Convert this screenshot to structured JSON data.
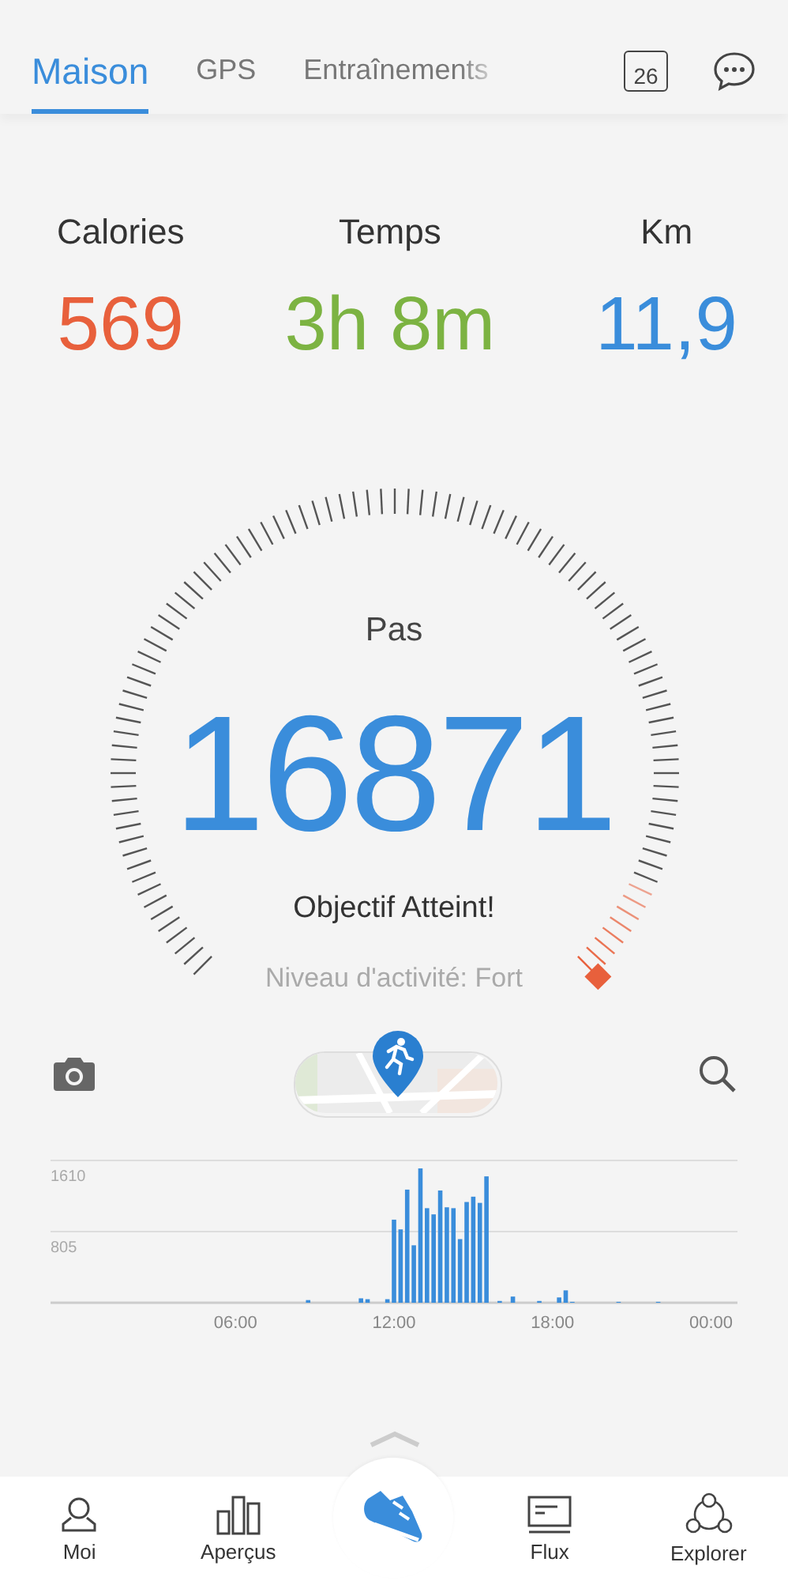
{
  "tabs": [
    {
      "label": "Maison",
      "selected": true
    },
    {
      "label": "GPS",
      "selected": false
    },
    {
      "label": "Entraînements",
      "selected": false
    }
  ],
  "calendar_day": "26",
  "stats": [
    {
      "label": "Calories",
      "value": "569",
      "color": "#e8603c"
    },
    {
      "label": "Temps",
      "value": "3h 8m",
      "color": "#7cb342"
    },
    {
      "label": "Km",
      "value": "11,9",
      "color": "#3a8ddb"
    }
  ],
  "gauge": {
    "title": "Pas",
    "value": "16871",
    "status": "Objectif Atteint!",
    "activity": "Niveau d'activité: Fort"
  },
  "chart_data": {
    "type": "bar",
    "x": [
      8.75,
      10.75,
      11,
      11.75,
      12,
      12.25,
      12.5,
      12.75,
      13,
      13.25,
      13.5,
      13.75,
      14,
      14.25,
      14.5,
      14.75,
      15,
      15.25,
      15.5,
      16,
      16.5,
      17.5,
      18.25,
      18.5,
      18.75,
      20.5,
      22
    ],
    "series": [
      {
        "color": "#3a8ddb",
        "values": [
          30,
          50,
          40,
          40,
          940,
          830,
          1280,
          650,
          1520,
          1070,
          1000,
          1270,
          1080,
          1070,
          720,
          1140,
          1200,
          1130,
          1430,
          20,
          70,
          20,
          60,
          140,
          10,
          10,
          10
        ]
      }
    ],
    "xlim": [
      -1,
      25
    ],
    "ylim": [
      0,
      1610
    ],
    "xticks": [
      {
        "value": 6,
        "label": "06:00"
      },
      {
        "value": 12,
        "label": "12:00"
      },
      {
        "value": 18,
        "label": "18:00"
      },
      {
        "value": 24,
        "label": "00:00"
      }
    ],
    "yticks": [
      805,
      1610
    ]
  },
  "nav": [
    {
      "label": "Moi",
      "kind": "person"
    },
    {
      "label": "Aperçus",
      "kind": "bars"
    },
    {
      "kind": "shoe"
    },
    {
      "label": "Flux",
      "kind": "feed"
    },
    {
      "label": "Explorer",
      "kind": "network"
    }
  ]
}
